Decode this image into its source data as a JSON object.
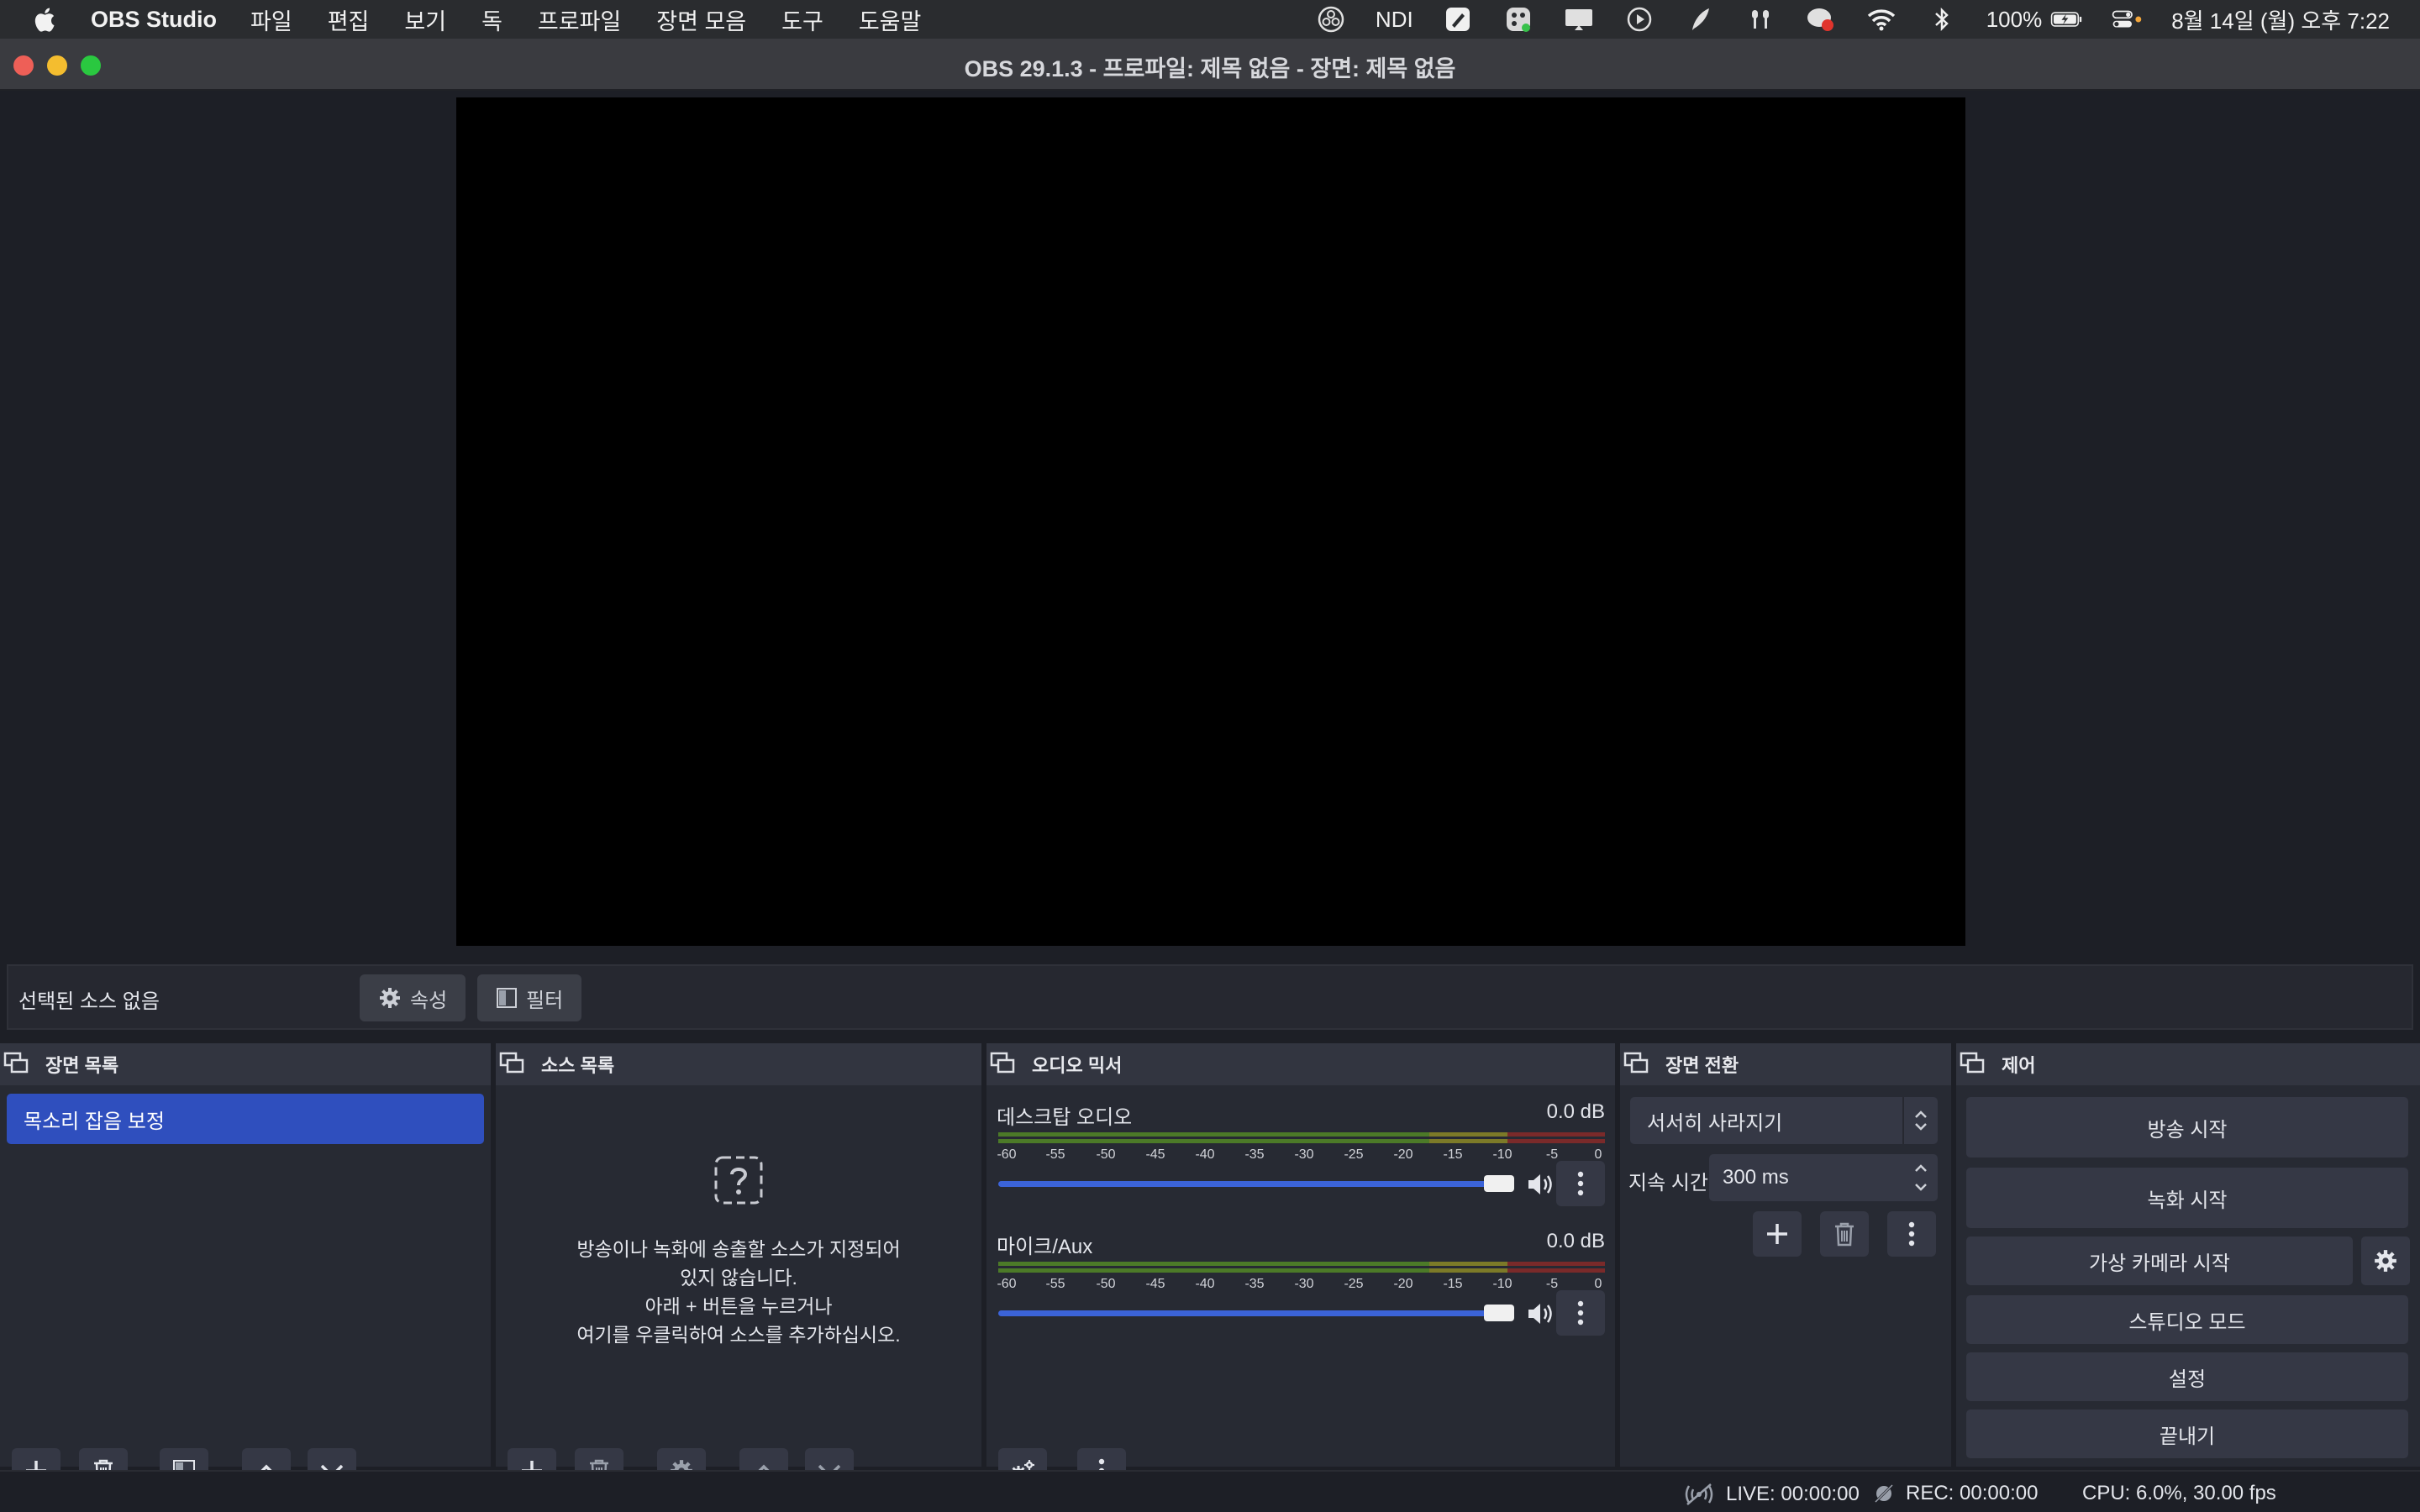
{
  "menubar": {
    "app_name": "OBS Studio",
    "items": [
      "파일",
      "편집",
      "보기",
      "독",
      "프로파일",
      "장면 모음",
      "도구",
      "도움말"
    ],
    "tray_ndi": "NDI",
    "battery": "100%",
    "datetime": "8월 14일 (월) 오후 7:22"
  },
  "window": {
    "title": "OBS 29.1.3 - 프로파일: 제목 없음 - 장면: 제목 없음"
  },
  "context": {
    "label": "선택된 소스 없음",
    "properties": "속성",
    "filters": "필터"
  },
  "docks": {
    "scenes": {
      "title": "장면 목록",
      "items": [
        "목소리 잡음 보정"
      ]
    },
    "sources": {
      "title": "소스 목록",
      "empty_lines": [
        "방송이나 녹화에 송출할 소스가 지정되어",
        "있지 않습니다.",
        "아래 + 버튼을 누르거나",
        "여기를 우클릭하여 소스를 추가하십시오."
      ]
    },
    "mixer": {
      "title": "오디오 믹서",
      "ticks": [
        "-60",
        "-55",
        "-50",
        "-45",
        "-40",
        "-35",
        "-30",
        "-25",
        "-20",
        "-15",
        "-10",
        "-5",
        "0"
      ],
      "channels": [
        {
          "name": "데스크탑 오디오",
          "db": "0.0 dB",
          "volume": 1.0
        },
        {
          "name": "마이크/Aux",
          "db": "0.0 dB",
          "volume": 1.0
        }
      ]
    },
    "transitions": {
      "title": "장면 전환",
      "selected": "서서히 사라지기",
      "duration_label": "지속 시간",
      "duration_value": "300 ms"
    },
    "controls": {
      "title": "제어",
      "start_stream": "방송 시작",
      "start_record": "녹화 시작",
      "virtual_cam": "가상 카메라 시작",
      "studio_mode": "스튜디오 모드",
      "settings": "설정",
      "exit": "끝내기"
    }
  },
  "status": {
    "live": "LIVE: 00:00:00",
    "rec": "REC: 00:00:00",
    "cpu": "CPU: 6.0%, 30.00 fps"
  },
  "colors": {
    "accent": "#2f4fbe",
    "slider": "#3b63d8",
    "dock_bg": "#272a33",
    "button_bg": "#353845"
  }
}
